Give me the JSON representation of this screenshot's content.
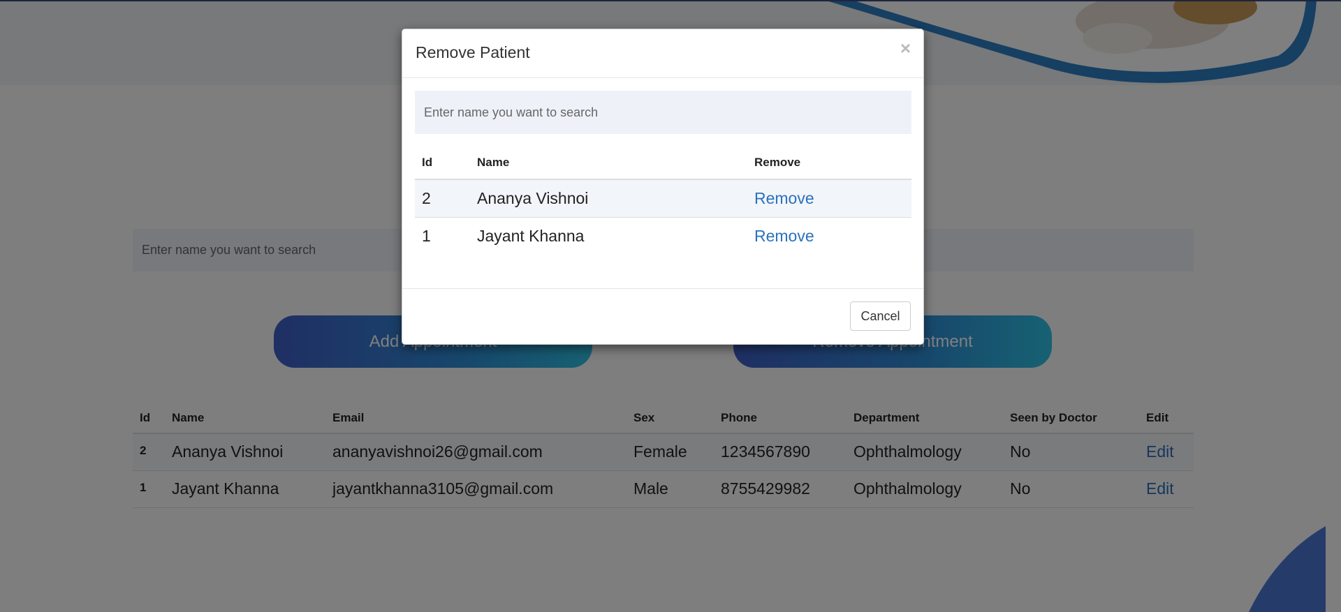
{
  "background": {
    "search": {
      "placeholder": "Enter name you want to search"
    },
    "buttons": {
      "add_label": "Add Appointment",
      "remove_label": "Remove Appointment"
    },
    "table": {
      "headers": [
        "Id",
        "Name",
        "Email",
        "Sex",
        "Phone",
        "Department",
        "Seen by Doctor",
        "Edit"
      ],
      "rows": [
        {
          "id": "2",
          "name": "Ananya Vishnoi",
          "email": "ananyavishnoi26@gmail.com",
          "sex": "Female",
          "phone": "1234567890",
          "department": "Ophthalmology",
          "seen": "No",
          "edit": "Edit"
        },
        {
          "id": "1",
          "name": "Jayant Khanna",
          "email": "jayantkhanna3105@gmail.com",
          "sex": "Male",
          "phone": "8755429982",
          "department": "Ophthalmology",
          "seen": "No",
          "edit": "Edit"
        }
      ]
    }
  },
  "modal": {
    "title": "Remove Patient",
    "close_glyph": "×",
    "search": {
      "placeholder": "Enter name you want to search"
    },
    "table": {
      "headers": [
        "Id",
        "Name",
        "Remove"
      ],
      "rows": [
        {
          "id": "2",
          "name": "Ananya Vishnoi",
          "action": "Remove"
        },
        {
          "id": "1",
          "name": "Jayant Khanna",
          "action": "Remove"
        }
      ]
    },
    "cancel_label": "Cancel"
  },
  "colors": {
    "accent_link": "#2a72bd",
    "gradient_start": "#3f5fc8",
    "gradient_end": "#2ec3e6",
    "overlay": "rgba(0,0,0,0.5)"
  }
}
